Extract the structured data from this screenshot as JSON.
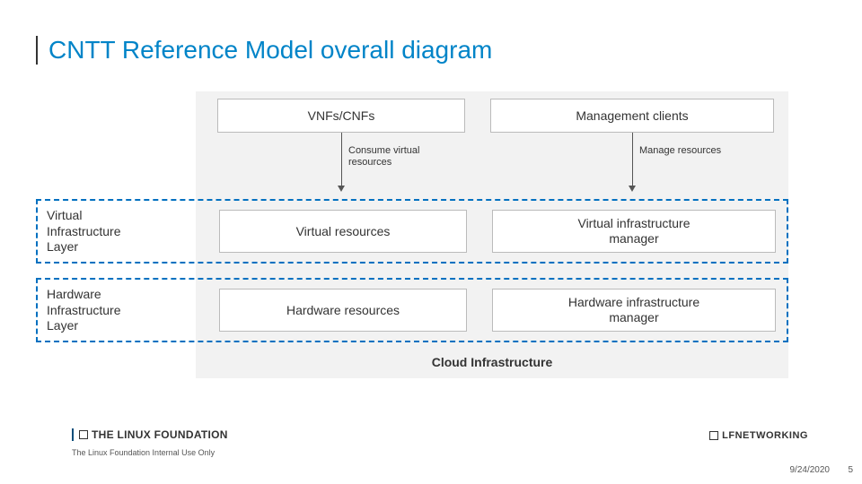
{
  "title": "CNTT Reference Model  overall diagram",
  "top": {
    "vnfs": "VNFs/CNFs",
    "mgmt": "Management clients"
  },
  "arrows": {
    "left": "Consume virtual\nresources",
    "right": "Manage resources"
  },
  "layers": {
    "virtual": {
      "label": "Virtual\nInfrastructure\nLayer",
      "left_box": "Virtual resources",
      "right_box": "Virtual infrastructure\nmanager"
    },
    "hardware": {
      "label": "Hardware\nInfrastructure\nLayer",
      "left_box": "Hardware resources",
      "right_box": "Hardware infrastructure\nmanager"
    }
  },
  "cloud_label": "Cloud Infrastructure",
  "footer": {
    "lf_logo": "THE LINUX FOUNDATION",
    "lfn_logo": "LFNETWORKING",
    "note": "The Linux Foundation Internal Use Only",
    "date": "9/24/2020",
    "page": "5"
  }
}
